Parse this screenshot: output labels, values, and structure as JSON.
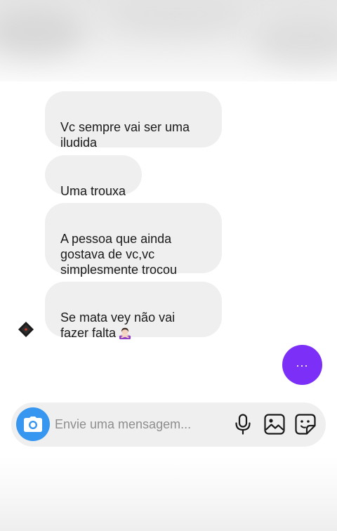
{
  "messages": [
    {
      "text": "Vc sempre vai ser uma\niludida"
    },
    {
      "text": "Uma trouxa"
    },
    {
      "text": "A pessoa que ainda\ngostava de vc,vc\nsimplesmente trocou"
    },
    {
      "text": "Se mata vey não vai\nfazer falta",
      "emoji": "person-gesturing-no"
    }
  ],
  "typing_indicator": {
    "label": "...",
    "color": "#7b2ff7"
  },
  "composer": {
    "placeholder": "Envie uma mensagem...",
    "camera_color": "#3797f0",
    "icons": [
      "camera-icon",
      "microphone-icon",
      "gallery-icon",
      "sticker-icon"
    ]
  },
  "colors": {
    "incoming_bubble": "#efefef",
    "text": "#1a1a1a"
  }
}
